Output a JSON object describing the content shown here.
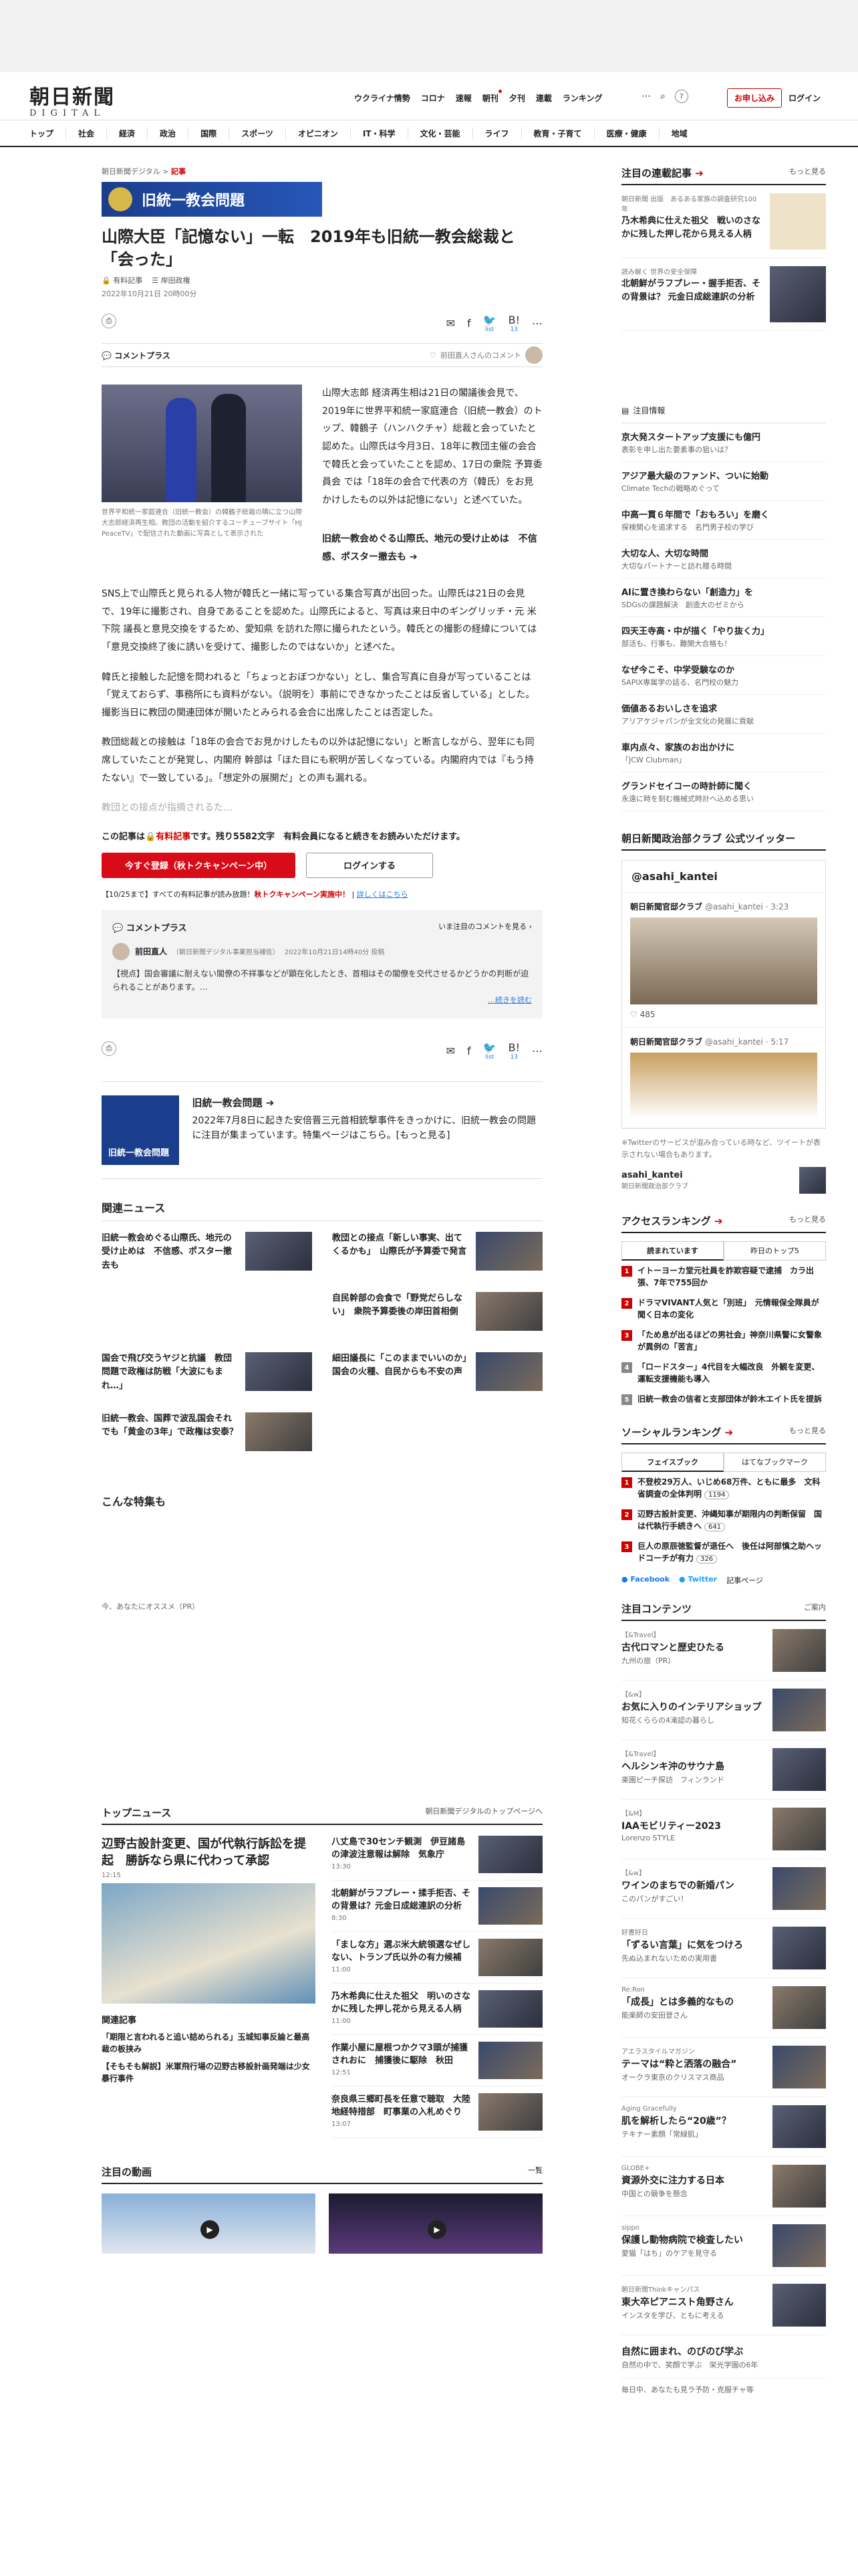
{
  "header": {
    "logo_jp": "朝日新聞",
    "logo_en": "DIGITAL",
    "top_links": [
      "ウクライナ情勢",
      "コロナ",
      "速報",
      "朝刊",
      "夕刊",
      "連載",
      "ランキング"
    ],
    "signup": "お申し込み",
    "login": "ログイン"
  },
  "catnav": [
    "トップ",
    "社会",
    "経済",
    "政治",
    "国際",
    "スポーツ",
    "オピニオン",
    "IT・科学",
    "文化・芸能",
    "ライフ",
    "教育・子育て",
    "医療・健康",
    "地域"
  ],
  "article": {
    "crumb_site": "朝日新聞デジタル",
    "crumb_type": "記事",
    "banner": "旧統一教会問題",
    "title": "山際大臣「記憶ない」一転　2019年も旧統一教会総裁と「会った」",
    "paid_label": "有料記事",
    "author": "岸田政権",
    "date": "2022年10月21日 20時00分",
    "share_small_1": "list",
    "share_small_2": "13",
    "comment_plus": "コメントプラス",
    "comment_by": "前田直人さんのコメント",
    "lead": "山際大志郎 経済再生相は21日の閣議後会見で、2019年に世界平和統一家庭連合（旧統一教会）のトップ、韓鶴子（ハンハクチャ）総裁と会っていたと認めた。山際氏は今月3日、18年に教団主催の会合で韓氏と会っていたことを認め、17日の衆院 予算委員会 では「18年の会合で代表の方（韓氏）をお見かけしたもの以外は記憶にない」と述べていた。",
    "caption": "世界平和統一家庭連合（旧統一教会）の韓鶴子総裁の隣に立つ山際大志郎経済再生相。教団の活動を紹介するユーチューブサイト「HJ　PeaceTV」で配信された動画に写真として表示された",
    "related_inline": "旧統一教会めぐる山際氏、地元の受け止めは　不信感、ポスター撤去も",
    "paragraphs": [
      "SNS上で山際氏と見られる人物が韓氏と一緒に写っている集合写真が出回った。山際氏は21日の会見で、19年に撮影され、自身であることを認めた。山際氏によると、写真は来日中のギングリッチ・元 米下院 議長と意見交換をするため、愛知県 を訪れた際に撮られたという。韓氏との撮影の経緯については「意見交換終了後に誘いを受けて、撮影したのではないか」と述べた。",
      "韓氏と接触した記憶を問われると「ちょっとおぼつかない」とし、集合写真に自身が写っていることは「覚えておらず、事務所にも資料がない。（説明を）事前にできなかったことは反省している」とした。撮影当日に教団の関連団体が開いたとみられる会合に出席したことは否定した。",
      "教団総裁との接触は「18年の会合でお見かけしたもの以外は記憶にない」と断言しながら、翌年にも同席していたことが発覚し、内閣府 幹部は「ほた目にも釈明が苦しくなっている。内閣府内では『もう持たない』で一致している」。「想定外の展開だ」との声も漏れる。"
    ],
    "fade_line": "教団との接点が指摘されるた…",
    "pw_prefix": "この記事は",
    "pw_paid": "有料記事",
    "pw_suffix": "です。残り5582文字　有料会員になると続きをお読みいただけます。",
    "btn_signup": "今すぐ登録（秋トクキャンペーン中）",
    "btn_login": "ログインする",
    "campaign_a": "【10/25まで】すべての有料記事が読み放題！",
    "campaign_b": "秋トクキャンペーン実施中！",
    "campaign_c": "詳しくはこちら"
  },
  "comment_box": {
    "head": "コメントプラス",
    "head_right": "いま注目のコメントを見る",
    "name": "前田直人",
    "role": "（朝日新聞デジタル事業担当補佐）",
    "time": "2022年10月21日14時40分 投稿",
    "text": "【視点】国会審議に耐えない閣僚の不祥事などが顕在化したとき、首相はその閣僚を交代させるかどうかの判断が迫られることがあります。…",
    "more": "…続きを読む"
  },
  "feature": {
    "img_label": "旧統一教会問題",
    "title": "旧統一教会問題",
    "desc": "2022年7月8日に起きた安倍晋三元首相銃撃事件をきっかけに、旧統一教会の問題に注目が集まっています。特集ページはこちら。[もっと見る]"
  },
  "related": {
    "title": "関連ニュース",
    "items": [
      "旧統一教会めぐる山際氏、地元の受け止めは　不信感、ポスター撤去も",
      "教団との接点「新しい事実、出てくるかも」　山際氏が予算委で発言",
      "自民幹部の会食で「野党だらしない」　衆院予算委後の岸田首相側",
      "国会で飛び交うヤジと抗議　教団問題で政権は防戦「大波にもまれ…」",
      "細田議長に「このままでいいのか」　国会の火種、自民からも不安の声",
      "旧統一教会、国葬で波乱国会それでも「黄金の3年」で政権は安泰？"
    ]
  },
  "special_title": "こんな特集も",
  "recommend_label": "今、あなたにオススメ（PR）",
  "topnews": {
    "title": "トップニュース",
    "link": "朝日新聞デジタルのトップページへ",
    "main": "辺野古設計変更、国が代執行訴訟を提起　勝訴なら県に代わって承認",
    "main_time": "12:15",
    "rel_head": "関連記事",
    "rel": [
      "「期限と言われると追い詰められる」玉城知事反論と最高裁の板挟み",
      "【そもそも解説】米軍飛行場の辺野古移設計画発端は少女暴行事件"
    ],
    "items": [
      {
        "t": "八丈島で30センチ観測　伊豆諸島の津波注意報は解除　気象庁",
        "tm": "13:30"
      },
      {
        "t": "北朝鮮がラフプレー・揉手拒否、その背景は？元金日成総連訳の分析",
        "tm": "8:30"
      },
      {
        "t": "「ましな方」選ぶ米大統領選なぜしない、トランプ氏以外の有力候補",
        "tm": "11:00"
      },
      {
        "t": "乃木希典に仕えた祖父　明いのさなかに残した押し花から見える人柄",
        "tm": "11:00"
      },
      {
        "t": "作業小屋に屋根つかクマ3頭が捕獲されおに　捕獲後に駆除　秋田",
        "tm": "12:51"
      },
      {
        "t": "奈良県三郷町長を任意で聴取　大陸地経特措部　町事業の入札めぐり",
        "tm": "13:07"
      }
    ]
  },
  "video": {
    "title": "注目の動画",
    "more": "一覧"
  },
  "sidebar": {
    "picks_title": "注目の連載記事",
    "more": "もっと見る",
    "picks": [
      {
        "k": "朝日新聞 出版　あるある家族の調査研究100年",
        "t": "乃木希典に仕えた祖父　戦いのさなかに残した押し花から見える人柄"
      },
      {
        "k": "読み解く 世界の安全保障",
        "t": "北朝鮮がラフプレー・握手拒否、その背景は？ 元金日成総連訳の分析"
      }
    ],
    "notice": "注目情報",
    "list": [
      {
        "t": "京大発スタートアップ支援にも億円",
        "s": "表彰を申し出た要素事の狙いは？"
      },
      {
        "t": "アジア最大級のファンド、ついに始動",
        "s": "Climate Techの戦略めぐって"
      },
      {
        "t": "中高一貫６年間で「おもろい」を磨く",
        "s": "探検関心を追求する　名門男子校の学び"
      },
      {
        "t": "大切な人、大切な時間",
        "s": "大切なパートナーと訪れ贈る時間"
      },
      {
        "t": "AIに置き換わらない「創造力」を",
        "s": "SDGsの課題解決　創造大のゼミから"
      },
      {
        "t": "四天王寺高・中が描く「やり抜く力」",
        "s": "部活も、行事も、難関大合格も！"
      },
      {
        "t": "なぜ今こそ、中学受験なのか",
        "s": "SAPIX専属学の話る、名門校の魅力"
      },
      {
        "t": "価値あるおいしさを追求",
        "s": "アリアケジャパンが全文化の発展に貢献"
      },
      {
        "t": "車内点々、家族のお出かけに",
        "s": "「JCW Clubman」"
      },
      {
        "t": "グランドセイコーの時計師に聞く",
        "s": "永遠に時を刻む機械式時計へ込める思い"
      }
    ],
    "tw_title": "朝日新聞政治部クラブ 公式ツイッター",
    "tw_handle": "@asahi_kantei",
    "tw_name": "朝日新聞官邸クラブ",
    "tw_time1": "3:23",
    "tw_time2": "5:17",
    "tw_likes": "485",
    "tw_foot": "※Twitterのサービスが混み合っている時など、ツイートが表示されない場合もあります。",
    "tw_acct": "asahi_kantei",
    "tw_acct_sub": "朝日新聞政治部クラブ",
    "access_title": "アクセスランキング",
    "access_tabs": [
      "読まれています",
      "昨日のトップ5"
    ],
    "access": [
      "イトーヨーカ堂元社員を詐欺容疑で逮捕　カラ出張、7年で755回か",
      "ドラマVIVANT人気と「別班」　元情報保全隊員が聞く日本の変化",
      "「ため息が出るほどの男社会」神奈川県警に女警象が異例の「苦言」",
      "「ロードスター」4代目を大幅改良　外観を変更、運転支援機能も導入",
      "旧統一教会の信者と支部団体が鈴木エイト氏を提訴"
    ],
    "social_title": "ソーシャルランキング",
    "social_tabs": [
      "フェイスブック",
      "はてなブックマーク"
    ],
    "social": [
      {
        "t": "不登校29万人、いじめ68万件、ともに最多　文科省調査の全体判明",
        "c": "1194"
      },
      {
        "t": "辺野古設計変更、沖縄知事が期限内の判断保留　国は代執行手続きへ",
        "c": "641"
      },
      {
        "t": "巨人の原辰徳監督が退任へ　後任は阿部慎之助ヘッドコーチが有力",
        "c": "326"
      }
    ],
    "social_links": [
      "Facebook",
      "Twitter",
      "記事ページ"
    ],
    "contents_title": "注目コンテンツ",
    "contents_link": "ご案内",
    "contents": [
      {
        "k": "【&Travel】",
        "t": "古代ロマンと歴史ひたる",
        "s": "九州の旅（PR）"
      },
      {
        "k": "【&w】",
        "t": "お気に入りのインテリアショップ",
        "s": "知花くららの4滝認の暮らし"
      },
      {
        "k": "【&Travel】",
        "t": "ヘルシンキ沖のサウナ島",
        "s": "楽園ピーチ探訪　フィンランド"
      },
      {
        "k": "【&M】",
        "t": "IAAモビリティー2023",
        "s": "Lorenzo STYLE"
      },
      {
        "k": "【&w】",
        "t": "ワインのまちでの新婚パン",
        "s": "このパンがすごい！"
      },
      {
        "k": "好書好日",
        "t": "「ずるい言葉」に気をつけろ",
        "s": "先ぬ込まれないための実用書"
      },
      {
        "k": "Re:Ron",
        "t": "「成長」とは多義的なもの",
        "s": "能楽師の安田登さん"
      },
      {
        "k": "アエラスタイルマガジン",
        "t": "テーマは“粋と洒落の融合”",
        "s": "オークラ東京のクリスマス商品"
      },
      {
        "k": "Aging Gracefully",
        "t": "肌を解析したら“20歳”？",
        "s": "テキナー素顔「常緑肌」"
      },
      {
        "k": "GLOBE+",
        "t": "資源外交に注力する日本",
        "s": "中国との競争を懸念"
      },
      {
        "k": "sippo",
        "t": "保護し動物病院で検査したい",
        "s": "愛猫「はち」のケアを見守る"
      },
      {
        "k": "朝日新聞Thinkキャンパス",
        "t": "東大卒ピアニスト角野さん",
        "s": "インスタを学び、ともに考える"
      },
      {
        "k": "",
        "t": "自然に囲まれ、のびのび学ぶ",
        "s": "自然の中で、笑顔で学ぶ　栄光学園の6年"
      }
    ],
    "last_item": "毎日中、あなたも見ラ予防・克服チャ等"
  }
}
